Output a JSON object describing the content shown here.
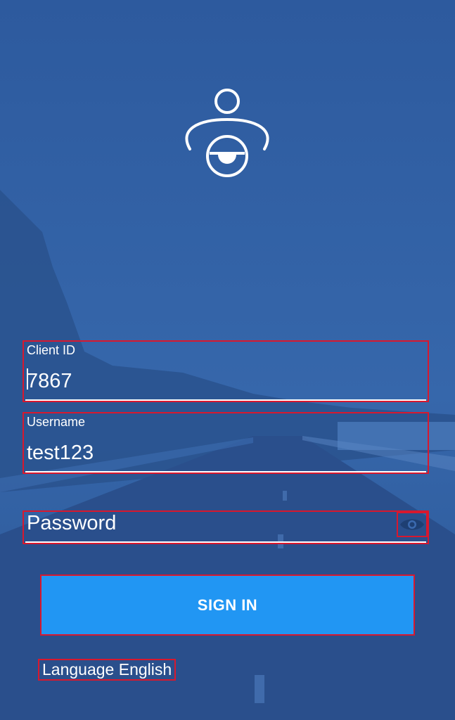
{
  "login": {
    "client_id": {
      "label": "Client ID",
      "value": "7867"
    },
    "username": {
      "label": "Username",
      "value": "test123"
    },
    "password": {
      "placeholder": "Password"
    },
    "sign_in_label": "SIGN IN",
    "language_label": "Language English"
  },
  "icons": {
    "logo": "baby-pacifier-logo-icon",
    "password_toggle": "eye-icon"
  },
  "colors": {
    "background": "#2f5c9f",
    "button": "#2196f3",
    "highlight_border": "#d8182e",
    "text": "#ffffff",
    "eye_icon": "#1e3f73"
  }
}
